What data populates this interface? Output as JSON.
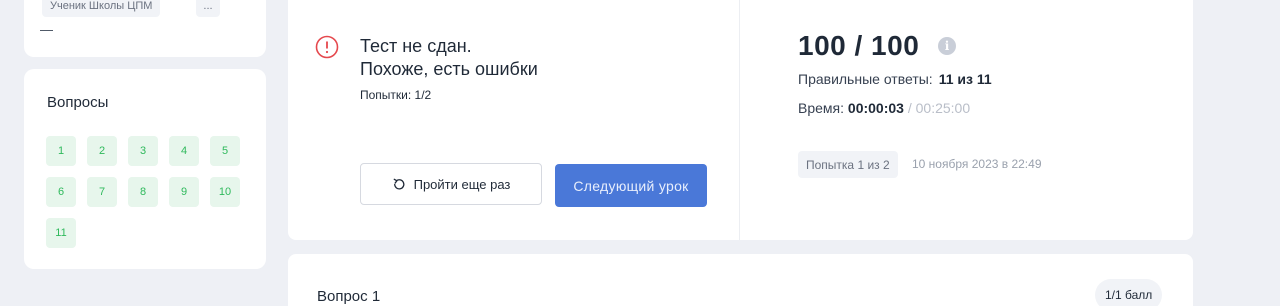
{
  "profile": {
    "role_tag": "Ученик Школы ЦПМ",
    "more_label": "...",
    "dash": "—"
  },
  "questions_nav": {
    "title": "Вопросы",
    "items": [
      "1",
      "2",
      "3",
      "4",
      "5",
      "6",
      "7",
      "8",
      "9",
      "10",
      "11"
    ],
    "status_color": "#2fb95c"
  },
  "result": {
    "status_title": "Тест не сдан.",
    "status_subtitle": "Похоже, есть ошибки",
    "attempts_text": "Попытки: 1/2",
    "retry_label": "Пройти еще раз",
    "next_label": "Следующий урок",
    "score": "100 / 100",
    "info_icon": "info-icon",
    "correct_label": "Правильные ответы:",
    "correct_value": "11 из  11",
    "time_label": "Время:",
    "time_value": "00:00:03",
    "time_limit": " / 00:25:00",
    "attempt_badge": "Попытка 1 из 2",
    "attempt_date": "10 ноября 2023 в 22:49",
    "accent_color": "#4a78d8",
    "warning_color": "#e5484d"
  },
  "question": {
    "title": "Вопрос 1",
    "points": "1/1 балл"
  }
}
